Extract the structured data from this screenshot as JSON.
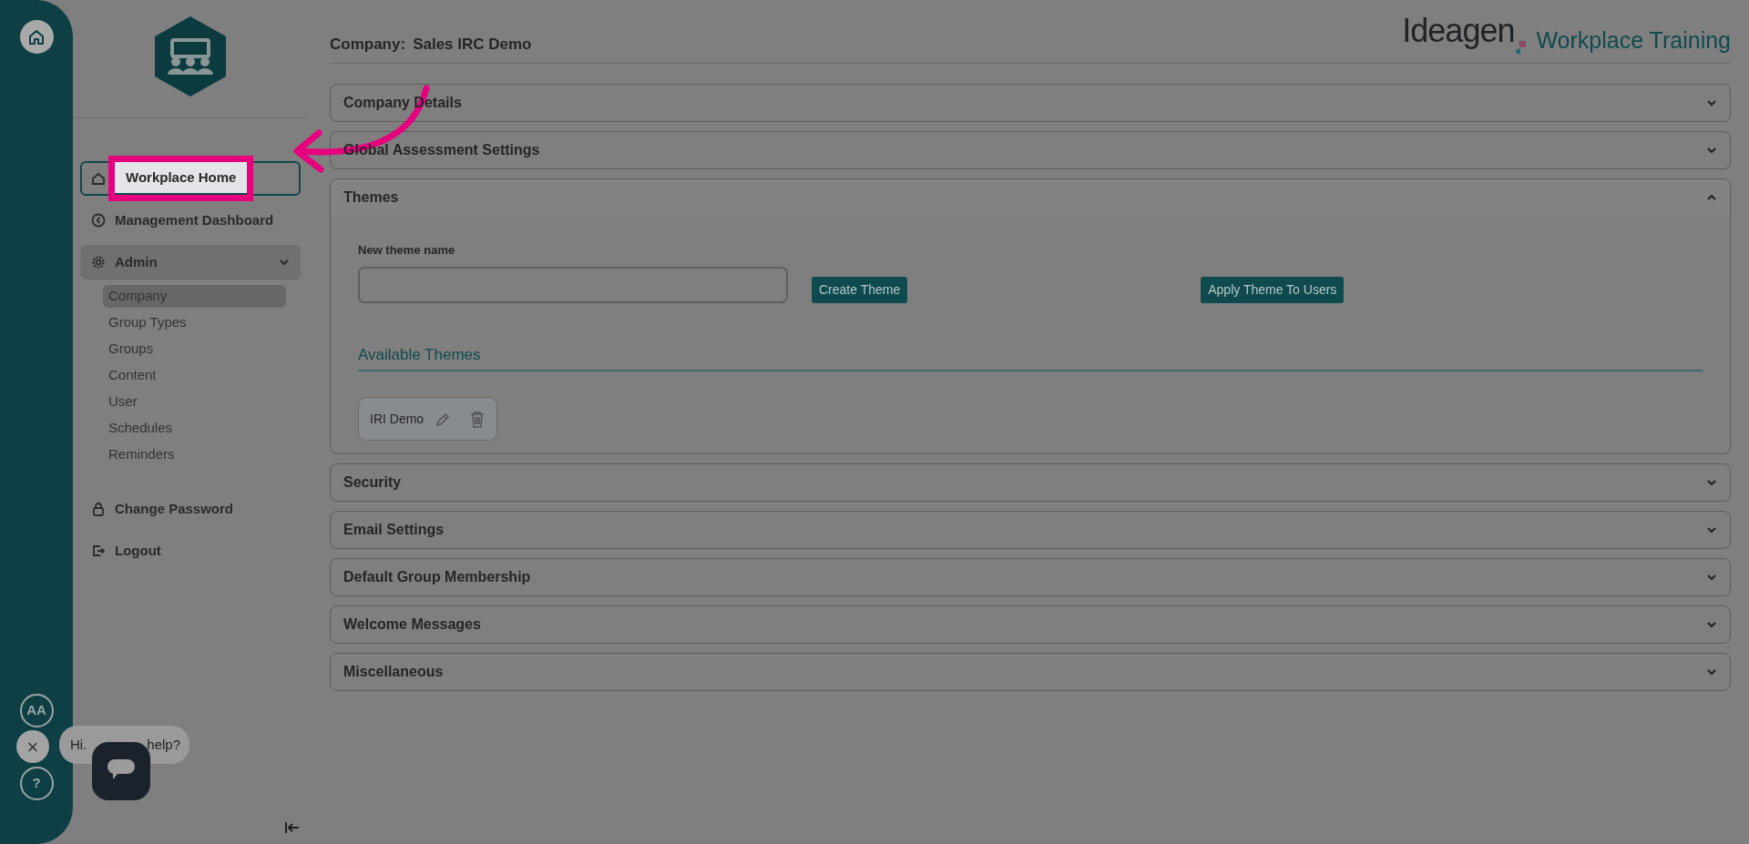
{
  "rail": {
    "font_button": "AA",
    "help_button": "?"
  },
  "sidebar": {
    "nav": [
      {
        "label": "Workplace Home",
        "highlighted": true
      },
      {
        "label": "Management Dashboard",
        "highlighted": false
      },
      {
        "label": "Admin",
        "highlighted": false,
        "expanded": true,
        "children": [
          {
            "label": "Company",
            "selected": true
          },
          {
            "label": "Group Types",
            "selected": false
          },
          {
            "label": "Groups",
            "selected": false
          },
          {
            "label": "Content",
            "selected": false
          },
          {
            "label": "User",
            "selected": false
          },
          {
            "label": "Schedules",
            "selected": false
          },
          {
            "label": "Reminders",
            "selected": false
          }
        ]
      },
      {
        "label": "Change Password",
        "highlighted": false
      },
      {
        "label": "Logout",
        "highlighted": false
      }
    ]
  },
  "chat": {
    "close": "×",
    "bubble_parts": [
      "Hi.",
      "help?"
    ]
  },
  "header": {
    "company_label": "Company:",
    "company_name": "Sales IRC Demo",
    "brand": "Ideagen",
    "product": "Workplace Training"
  },
  "sections": [
    {
      "title": "Company Details",
      "expanded": false
    },
    {
      "title": "Global Assessment Settings",
      "expanded": false
    },
    {
      "title": "Themes",
      "expanded": true,
      "content": {
        "field_label": "New theme name",
        "create_button": "Create Theme",
        "apply_button": "Apply Theme To Users",
        "list_title": "Available Themes",
        "themes": [
          {
            "name": "IRI Demo"
          }
        ]
      }
    },
    {
      "title": "Security",
      "expanded": false
    },
    {
      "title": "Email Settings",
      "expanded": false
    },
    {
      "title": "Default Group Membership",
      "expanded": false
    },
    {
      "title": "Welcome Messages",
      "expanded": false
    },
    {
      "title": "Miscellaneous",
      "expanded": false
    }
  ]
}
